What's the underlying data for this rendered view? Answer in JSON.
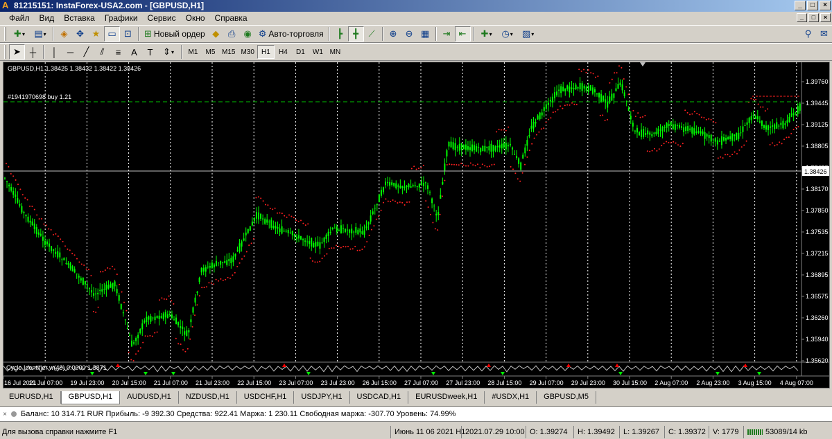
{
  "window": {
    "title": "81215151: InstaForex-USA2.com - [GBPUSD,H1]",
    "logo": "A",
    "buttons": [
      "_",
      "□",
      "×"
    ]
  },
  "menu": [
    "Файл",
    "Вид",
    "Вставка",
    "Графики",
    "Сервис",
    "Окно",
    "Справка"
  ],
  "toolbar": {
    "new_order": "Новый ордер",
    "auto_trading": "Авто-торговля"
  },
  "timeframes": [
    "M1",
    "M5",
    "M15",
    "M30",
    "H1",
    "H4",
    "D1",
    "W1",
    "MN"
  ],
  "active_timeframe": "H1",
  "chart": {
    "header": "GBPUSD,H1  1.38425 1.38432 1.38422 1.38426",
    "order_label": "#1941970698 buy 1.21",
    "current_price": "1.38426",
    "indicator_label": "Cycle Identifier w(46) 0.0000 1.3871",
    "colors": {
      "background": "#000000",
      "candles": "#00ff00",
      "sar": "#ff2020",
      "order_line": "#00c000",
      "grid": "#ffffff"
    },
    "price_labels": [
      "1.39760",
      "1.39445",
      "1.39125",
      "1.38805",
      "1.38490",
      "1.38170",
      "1.37850",
      "1.37535",
      "1.37215",
      "1.36895",
      "1.36575",
      "1.36260",
      "1.35940",
      "1.35620"
    ],
    "time_labels": [
      "16 Jul 2021",
      "19 Jul 07:00",
      "19 Jul 23:00",
      "20 Jul 15:00",
      "21 Jul 07:00",
      "21 Jul 23:00",
      "22 Jul 15:00",
      "23 Jul 07:00",
      "23 Jul 23:00",
      "26 Jul 15:00",
      "27 Jul 07:00",
      "27 Jul 23:00",
      "28 Jul 15:00",
      "29 Jul 07:00",
      "29 Jul 23:00",
      "30 Jul 15:00",
      "2 Aug 07:00",
      "2 Aug 23:00",
      "3 Aug 15:00",
      "4 Aug 07:00"
    ]
  },
  "symbol_tabs": [
    "EURUSD,H1",
    "GBPUSD,H1",
    "AUDUSD,H1",
    "NZDUSD,H1",
    "USDCHF,H1",
    "USDJPY,H1",
    "USDCAD,H1",
    "EURUSDweek,H1",
    "#USDX,H1",
    "GBPUSD,M5"
  ],
  "active_tab": "GBPUSD,H1",
  "account": "Баланс: 10 314.71 RUR  Прибыль: -9 392.30  Средства: 922.41  Маржа: 1 230.11  Свободная маржа: -307.70  Уровень: 74.99%",
  "status": {
    "help": "Для вызова справки нажмите F1",
    "profile": "Июнь 11 06 2021 H1",
    "datetime": "2021.07.29 10:00",
    "open": "O: 1.39274",
    "high": "H: 1.39492",
    "low": "L: 1.39267",
    "close": "C: 1.39372",
    "volume": "V: 1779",
    "traffic": "53089/14 kb"
  }
}
